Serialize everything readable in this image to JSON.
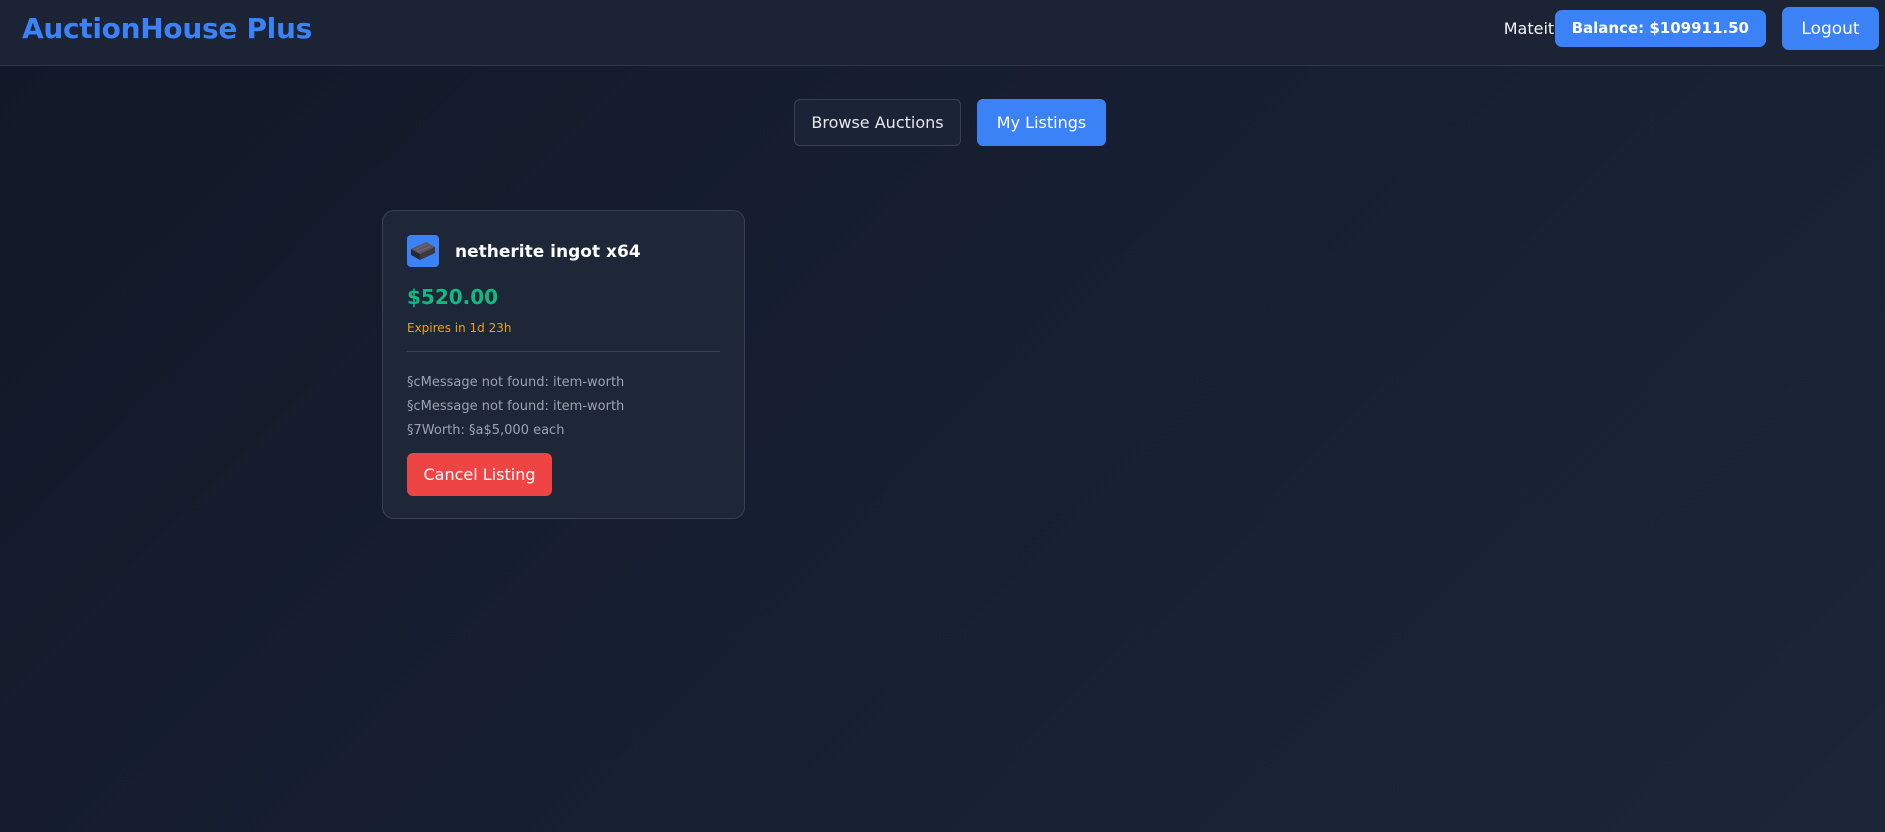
{
  "header": {
    "brand": "AuctionHouse Plus",
    "username": "Mateita",
    "balance": "Balance: $109911.50",
    "logout_label": "Logout",
    "accent_color": "#3b82f6"
  },
  "tabs": {
    "browse_label": "Browse Auctions",
    "mine_label": "My Listings",
    "active": "My Listings"
  },
  "listings": [
    {
      "icon": "netherite-ingot-icon",
      "name": "netherite ingot x64",
      "price": "$520.00",
      "expires": "Expires in 1d 23h",
      "lore": [
        "§cMessage not found: item-worth",
        "§cMessage not found: item-worth",
        "§7Worth: §a$5,000 each"
      ],
      "cancel_label": "Cancel Listing"
    }
  ],
  "colors": {
    "price": "#10b981",
    "expires": "#f59e0b",
    "cancel": "#ef4444"
  }
}
